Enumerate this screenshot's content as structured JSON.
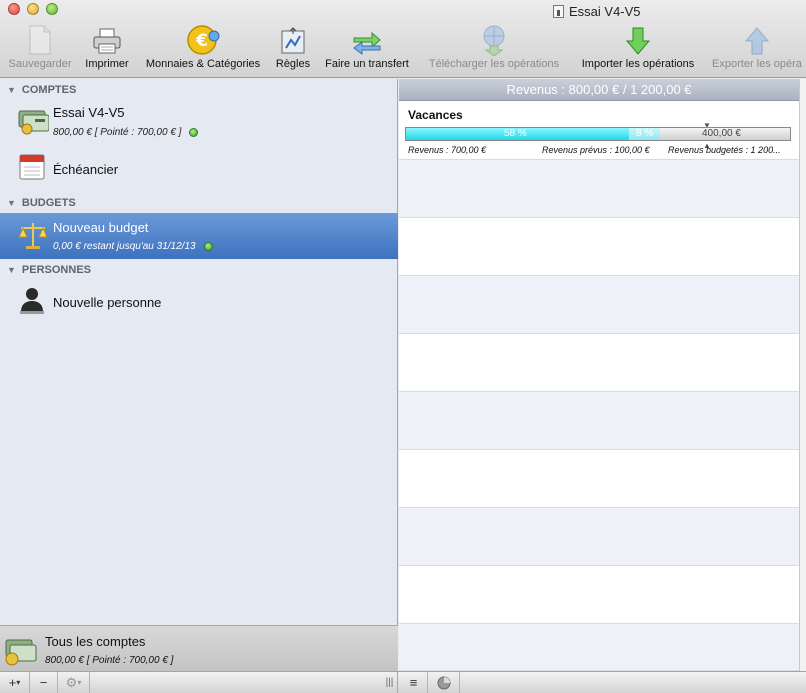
{
  "window": {
    "title": "Essai V4-V5"
  },
  "toolbar": {
    "save": "Sauvegarder",
    "print": "Imprimer",
    "currencies": "Monnaies & Catégories",
    "rules": "Règles",
    "transfer": "Faire un transfert",
    "download": "Télécharger les opérations",
    "import": "Importer les opérations",
    "export": "Exporter les opéra"
  },
  "sidebar": {
    "sections": {
      "accounts": "COMPTES",
      "budgets": "BUDGETS",
      "people": "PERSONNES"
    },
    "account": {
      "name": "Essai V4-V5",
      "detail": "800,00 € [ Pointé : 700,00 € ]"
    },
    "schedule": {
      "name": "Échéancier"
    },
    "budget": {
      "name": "Nouveau budget",
      "detail": "0,00 € restant jusqu'au 31/12/13"
    },
    "person": {
      "name": "Nouvelle personne"
    },
    "all_accounts": {
      "name": "Tous les comptes",
      "detail": "800,00 € [ Pointé : 700,00 € ]"
    }
  },
  "statusbar": {
    "add": "+",
    "remove": "−"
  },
  "content": {
    "header": "Revenus : 800,00 € / 1 200,00 €",
    "budget_item": {
      "title": "Vacances",
      "percent_done": "58 %",
      "percent_planned": "8 %",
      "remaining": "400,00 €",
      "revenue": "Revenus : 700,00 €",
      "planned": "Revenus prévus : 100,00 €",
      "budgeted": "Revenus budgetés : 1 200..."
    }
  },
  "chart_data": {
    "type": "bar",
    "categories": [
      "Vacances"
    ],
    "series": [
      {
        "name": "Revenus",
        "values": [
          58
        ]
      },
      {
        "name": "Revenus prévus",
        "values": [
          8
        ]
      }
    ],
    "ylim": [
      0,
      100
    ]
  },
  "colors": {
    "selection": "#3e72bf",
    "progress": "#22d8e8",
    "status_ok": "#2f9e1c"
  }
}
